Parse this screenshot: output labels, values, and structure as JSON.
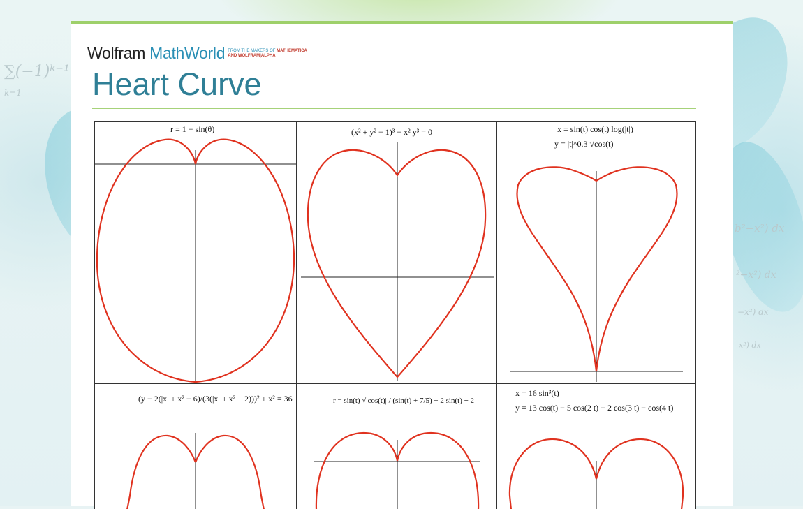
{
  "site": {
    "brand_wolfram": "Wolfram",
    "brand_mathworld": "MathWorld",
    "tagline_line1": "FROM THE MAKERS OF",
    "tagline_line1_bold": "MATHEMATICA",
    "tagline_line2": "AND WOLFRAM|ALPHA"
  },
  "page": {
    "title": "Heart Curve"
  },
  "background": {
    "formula_left": "∑(−1)ᵏ⁻¹",
    "formula_left_sub": "k=1",
    "formula_left_sup": "∞",
    "formula_right_1": "b²−x²) dx",
    "formula_right_2": "²−x²) dx",
    "formula_right_3": "−x²) dx",
    "formula_right_4": "x²) dx"
  },
  "figure": {
    "panels": [
      {
        "equation_line1": "r = 1 − sin(θ)",
        "equation_line2": ""
      },
      {
        "equation_line1": "(x² + y² − 1)³ − x² y³ = 0",
        "equation_line2": ""
      },
      {
        "equation_line1": "x = sin(t) cos(t) log(|t|)",
        "equation_line2": "y = |t|^0.3 √cos(t)"
      },
      {
        "equation_line1": "(y − 2(|x| + x² − 6)/(3(|x| + x² + 2)))² + x² = 36",
        "equation_line2": ""
      },
      {
        "equation_line1": "r = sin(t) √|cos(t)| / (sin(t) + 7/5) − 2 sin(t) + 2",
        "equation_line2": ""
      },
      {
        "equation_line1": "x = 16 sin³(t)",
        "equation_line2": "y = 13 cos(t) − 5 cos(2 t) − 2 cos(3 t) − cos(4 t)"
      }
    ]
  },
  "colors": {
    "curve": "#e0321f",
    "accent_green": "#9ed06a",
    "title_teal": "#2f7f96",
    "brand_blue": "#2a8fb5"
  }
}
